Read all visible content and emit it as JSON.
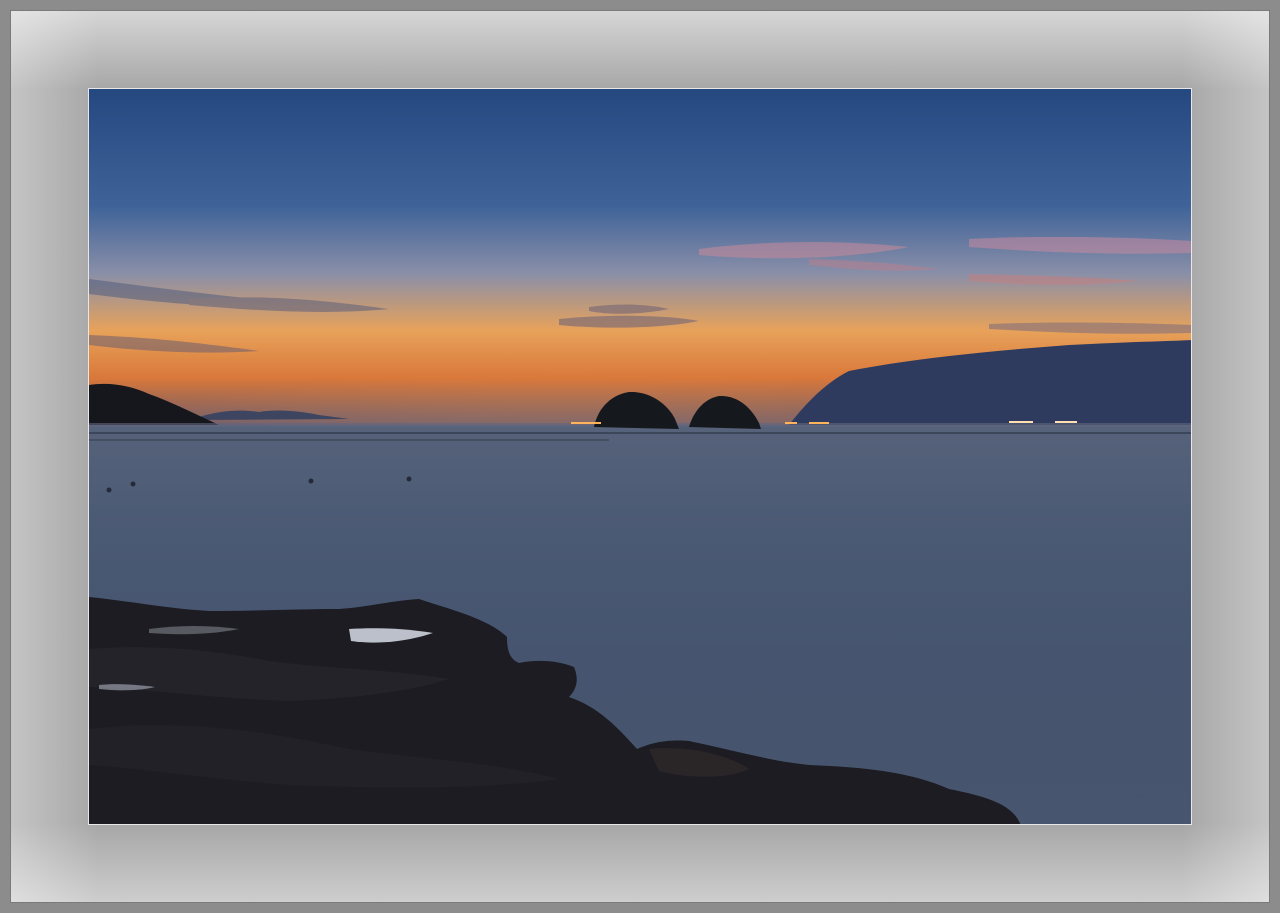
{
  "frame": {
    "outer_color": "#8c8c8c",
    "mat_color": "#a6a6a6",
    "photo_border_color": "#e8e8e8"
  },
  "photo": {
    "subject": "coastal-sunset-seascape",
    "colors": {
      "sky_top": "#2a4f86",
      "sky_mid": "#5d79a6",
      "sky_glow": "#f0a14a",
      "horizon": "#d9783a",
      "sea_far": "#46556f",
      "sea_near": "#2f3d55",
      "rock": "#1d1d22",
      "island": "#15181d",
      "cloud_bank": "#2e3b5e",
      "light_dots": "#ffb35a"
    }
  }
}
